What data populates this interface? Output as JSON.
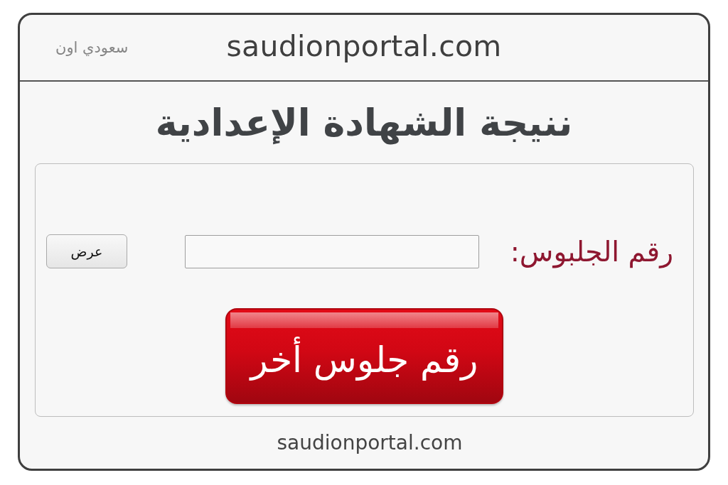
{
  "header": {
    "brand": "سعودي اون",
    "domain": "saudionportal.com"
  },
  "title": "ننيجة الشهادة الإعدادية",
  "form": {
    "label": "رقم الجلبوس:",
    "show_button": "عرض",
    "primary_button": "رقم جلوس أخر"
  },
  "footer": {
    "domain": "saudionportal.com"
  }
}
